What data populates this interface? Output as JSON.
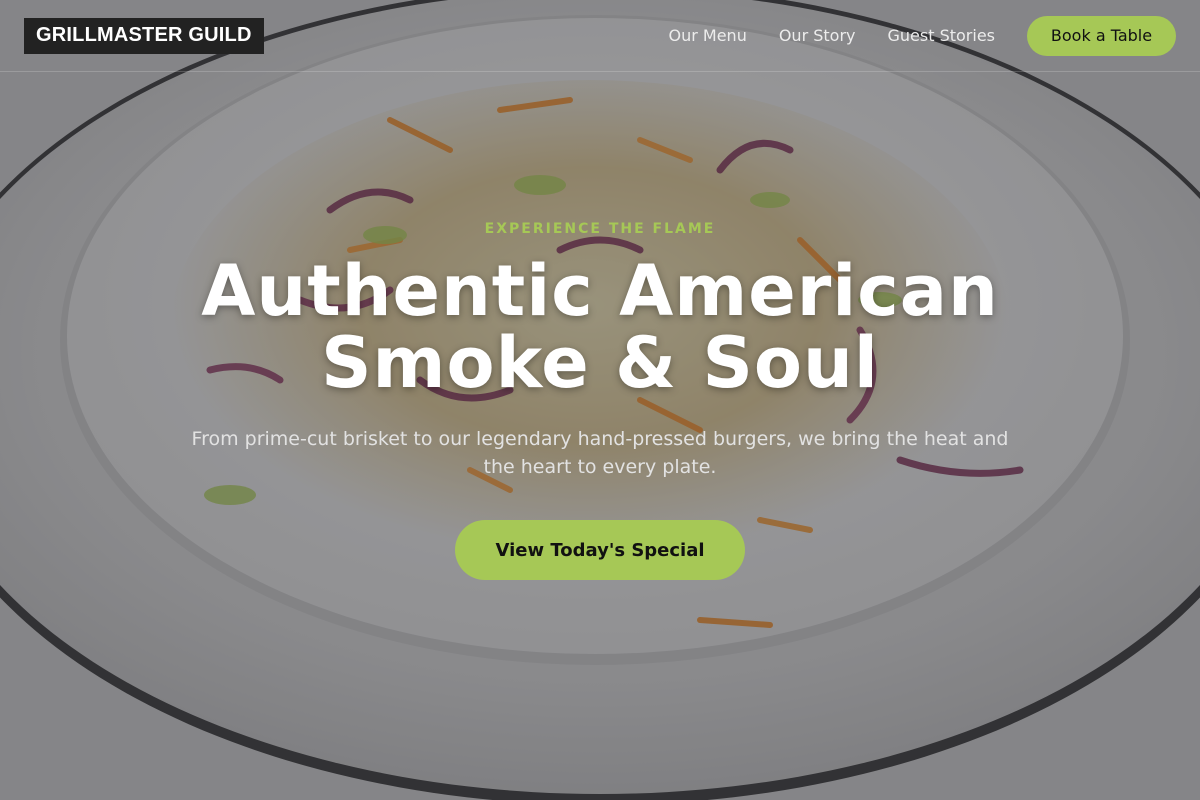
{
  "header": {
    "logo": "GRILLMASTER GUILD",
    "nav": [
      {
        "label": "Our Menu"
      },
      {
        "label": "Our Story"
      },
      {
        "label": "Guest Stories"
      }
    ],
    "book_button": "Book a Table"
  },
  "hero": {
    "eyebrow": "EXPERIENCE THE FLAME",
    "headline_line1": "Authentic American",
    "headline_line2": "Smoke & Soul",
    "subtext": "From prime-cut brisket to our legendary hand-pressed burgers, we bring the heat and the heart to every plate.",
    "cta": "View Today's Special",
    "background_image": "plate-of-coleslaw"
  },
  "colors": {
    "accent": "#a6c856",
    "logo_bg": "#222222",
    "headline": "#ffffff",
    "subtext": "#e2e2e2"
  }
}
